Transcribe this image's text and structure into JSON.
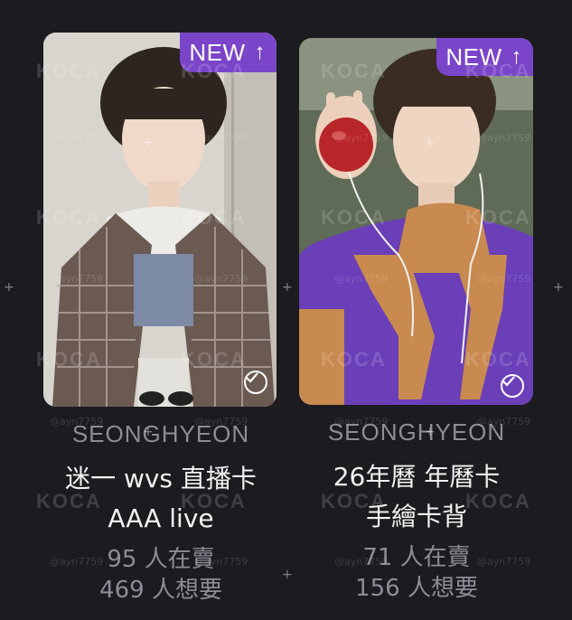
{
  "cards": [
    {
      "badge_label": "NEW",
      "badge_icon": "arrow-up-icon",
      "selected": true,
      "artist": "SEONGHYEON",
      "title_line1": "迷一 wvs 直播卡",
      "title_line2": "AAA live",
      "sellers": "95 人在賣",
      "wanters": "469 人想要"
    },
    {
      "badge_label": "NEW",
      "badge_icon": "arrow-up-icon",
      "selected": true,
      "artist": "SEONGHYEON",
      "title_line1": "26年曆 年曆卡",
      "title_line2": "手繪卡背",
      "sellers": "71 人在賣",
      "wanters": "156 人想要"
    }
  ],
  "watermark": {
    "logo": "KOCA",
    "handle": "@ayn7759"
  },
  "colors": {
    "background": "#1c1b1f",
    "badge": "#7a45c8",
    "muted_text": "#8e8c97",
    "title_text": "#f2f2f2"
  }
}
